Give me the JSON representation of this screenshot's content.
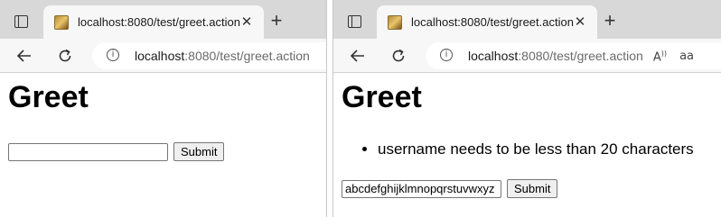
{
  "left_window": {
    "tab": {
      "title": "localhost:8080/test/greet.action"
    },
    "address": {
      "host": "localhost",
      "rest": ":8080/test/greet.action"
    },
    "page": {
      "heading": "Greet",
      "username_value": "",
      "submit_label": "Submit"
    }
  },
  "right_window": {
    "tab": {
      "title": "localhost:8080/test/greet.action"
    },
    "address": {
      "host": "localhost",
      "rest": ":8080/test/greet.action"
    },
    "toolbar": {
      "read_aloud": "Á̓",
      "aa": "aa"
    },
    "page": {
      "heading": "Greet",
      "errors": [
        "username needs to be less than 20 characters"
      ],
      "username_value": "abcdefghijklmnopqrstuvwxyz",
      "submit_label": "Submit"
    }
  },
  "icons": {
    "tab_actions": "tab-actions-icon",
    "favicon": "struts-favicon",
    "close": "✕",
    "new_tab": "+",
    "back": "back-arrow-icon",
    "reload": "reload-icon",
    "info": "i"
  }
}
